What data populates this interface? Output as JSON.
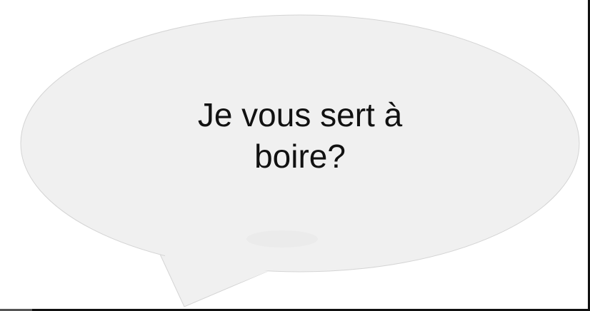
{
  "bubble": {
    "line1": "Je vous sert à",
    "line2": "boire?",
    "fill_color": "#f0f0f0",
    "stroke_color": "#d4d4d4"
  }
}
